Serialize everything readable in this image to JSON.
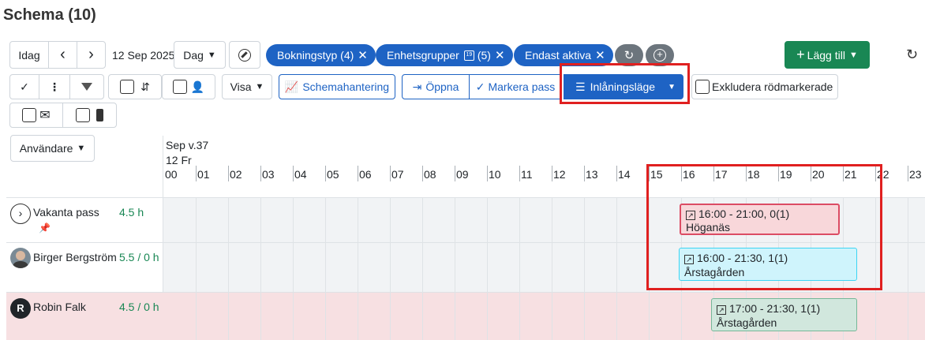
{
  "page": {
    "title": "Schema (10)"
  },
  "toolbar": {
    "today": "Idag",
    "prev": "‹",
    "next": "›",
    "date": "12 Sep 2025",
    "view": "Dag",
    "filters": [
      {
        "label": "Bokningstyp (4)"
      },
      {
        "label": "Enhetsgrupper",
        "count": "(5)"
      },
      {
        "label": "Endast aktiva"
      }
    ],
    "add": "Lägg till"
  },
  "toolbar2": {
    "visa": "Visa",
    "schema": "Schemahantering",
    "open": "Öppna",
    "mark": "Markera pass",
    "mode": "Inlåningsläge",
    "exclude": "Exkludera rödmarkerade"
  },
  "users_dropdown": "Användare",
  "header": {
    "week": "Sep v.37",
    "day": "12 Fr",
    "hours": [
      "00",
      "01",
      "02",
      "03",
      "04",
      "05",
      "06",
      "07",
      "08",
      "09",
      "10",
      "11",
      "12",
      "13",
      "14",
      "15",
      "16",
      "17",
      "18",
      "19",
      "20",
      "21",
      "22",
      "23"
    ]
  },
  "rows": [
    {
      "name": "Vakanta pass",
      "hours": "4.5 h"
    },
    {
      "name": "Birger Bergström",
      "hours": "5.5 / 0 h"
    },
    {
      "name": "Robin Falk",
      "hours": "4.5 / 0 h",
      "initial": "R"
    }
  ],
  "events": [
    {
      "time": "16:00 - 21:00, 0(1)",
      "place": "Höganäs"
    },
    {
      "time": "16:00 - 21:30, 1(1)",
      "place": "Årstagården"
    },
    {
      "time": "17:00 - 21:30, 1(1)",
      "place": "Årstagården"
    }
  ],
  "colors": {
    "primary": "#1e63c4",
    "success": "#198754",
    "highlight": "#e02020",
    "event_red_bg": "#f8d7da",
    "event_cyan_bg": "#cff4fc",
    "event_green_bg": "#d1e7dd",
    "row_red_bg": "#f7e0e2"
  }
}
